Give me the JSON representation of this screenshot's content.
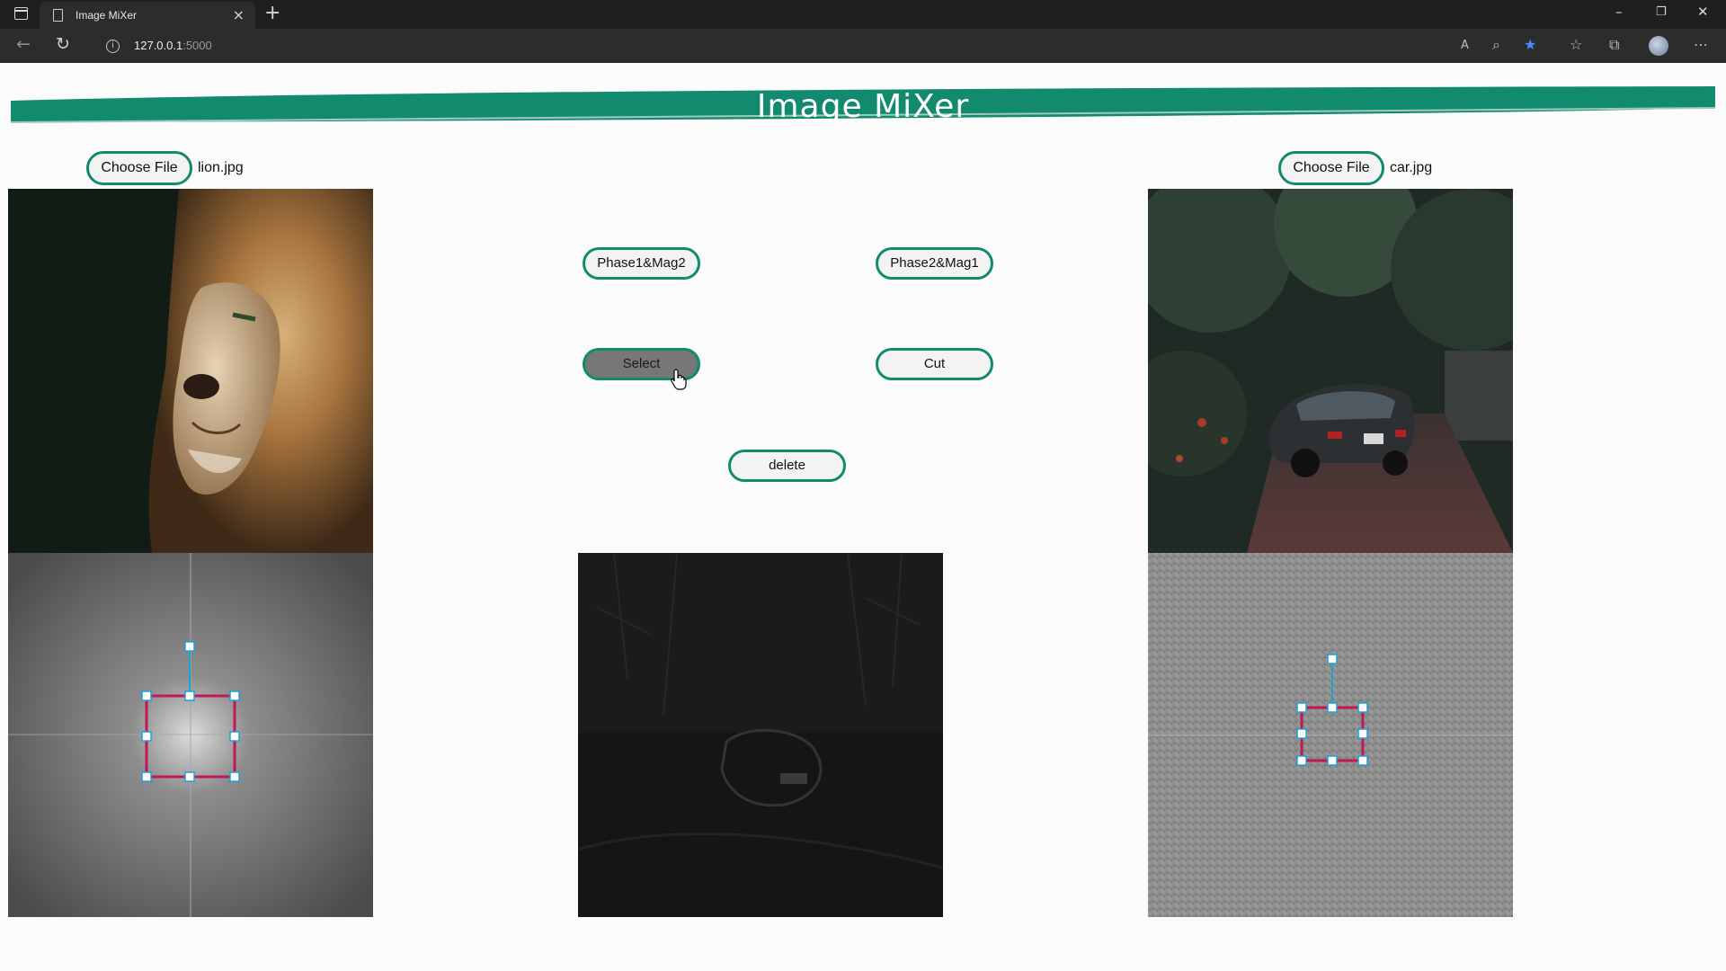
{
  "browser": {
    "tab_title": "Image MiXer",
    "tab_close": "×",
    "new_tab": "+",
    "url_host": "127.0.0.1",
    "url_port": ":5000",
    "controls": {
      "minimize": "–",
      "restore": "❐",
      "close": "✕"
    },
    "icons": [
      "back-arrow-icon",
      "refresh-icon",
      "info-icon",
      "read-aloud-icon",
      "zoom-icon",
      "favorite-star-icon",
      "favorites-icon",
      "collections-icon",
      "profile-icon",
      "more-icon"
    ]
  },
  "header": {
    "title": "Image MiXer"
  },
  "left_panel": {
    "choose_file_label": "Choose File",
    "file_name": "lion.jpg"
  },
  "right_panel": {
    "choose_file_label": "Choose File",
    "file_name": "car.jpg"
  },
  "controls": {
    "phase1_mag2": "Phase1&Mag2",
    "phase2_mag1": "Phase2&Mag1",
    "select": "Select",
    "cut": "Cut",
    "delete": "delete"
  },
  "colors": {
    "accent": "#128a6e",
    "selection_border": "#c2185b",
    "selection_handle": "#1ba3d4",
    "pressed_button": "#777777"
  }
}
